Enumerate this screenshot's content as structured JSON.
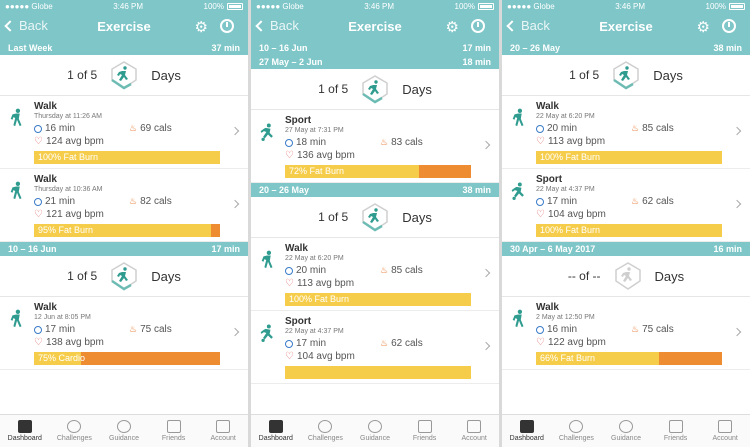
{
  "status": {
    "carrier": "Globe",
    "time": "3:46 PM",
    "battery": "100%"
  },
  "nav": {
    "back_label": "Back",
    "title": "Exercise"
  },
  "tabs": [
    "Dashboard",
    "Challenges",
    "Guidance",
    "Friends",
    "Account"
  ],
  "colors": {
    "teal": "#7fc6c8",
    "fat_burn": "#f6cd4a",
    "cardio": "#ee8c32"
  },
  "screens": [
    {
      "sections": [
        {
          "range": "Last Week",
          "total": "37 min",
          "goal_count": "1 of 5",
          "goal_unit": "Days",
          "items": [
            {
              "type": "Walk",
              "when": "Thursday at 11:26 AM",
              "duration": "16 min",
              "cals": "69 cals",
              "bpm": "124 avg bpm",
              "zone": "100% Fat Burn",
              "cardio_fraction": 0
            },
            {
              "type": "Walk",
              "when": "Thursday at 10:36 AM",
              "duration": "21 min",
              "cals": "82 cals",
              "bpm": "121 avg bpm",
              "zone": "95% Fat Burn",
              "cardio_fraction": 0.05
            }
          ]
        },
        {
          "range": "10 – 16 Jun",
          "total": "17 min",
          "goal_count": "1 of 5",
          "goal_unit": "Days",
          "items": [
            {
              "type": "Walk",
              "when": "12 Jun at 8:05 PM",
              "duration": "17 min",
              "cals": "75 cals",
              "bpm": "138 avg bpm",
              "zone": "75% Cardio",
              "cardio_fraction": 0.75
            }
          ]
        }
      ]
    },
    {
      "sections": [
        {
          "range": "10 – 16 Jun",
          "total": "17 min"
        },
        {
          "range": "27 May – 2 Jun",
          "total": "18 min",
          "goal_count": "1 of 5",
          "goal_unit": "Days",
          "items": [
            {
              "type": "Sport",
              "when": "27 May at 7:31 PM",
              "duration": "18 min",
              "cals": "83 cals",
              "bpm": "136 avg bpm",
              "zone": "72% Fat Burn",
              "cardio_fraction": 0.28
            }
          ]
        },
        {
          "range": "20 – 26 May",
          "total": "38 min",
          "goal_count": "1 of 5",
          "goal_unit": "Days",
          "items": [
            {
              "type": "Walk",
              "when": "22 May at 6:20 PM",
              "duration": "20 min",
              "cals": "85 cals",
              "bpm": "113 avg bpm",
              "zone": "100% Fat Burn",
              "cardio_fraction": 0
            },
            {
              "type": "Sport",
              "when": "22 May at 4:37 PM",
              "duration": "17 min",
              "cals": "62 cals",
              "bpm": "104 avg bpm",
              "zone": "",
              "cardio_fraction": 0
            }
          ]
        }
      ]
    },
    {
      "sections": [
        {
          "range": "20 – 26 May",
          "total": "38 min",
          "goal_count": "1 of 5",
          "goal_unit": "Days",
          "items": [
            {
              "type": "Walk",
              "when": "22 May at 6:20 PM",
              "duration": "20 min",
              "cals": "85 cals",
              "bpm": "113 avg bpm",
              "zone": "100% Fat Burn",
              "cardio_fraction": 0
            },
            {
              "type": "Sport",
              "when": "22 May at 4:37 PM",
              "duration": "17 min",
              "cals": "62 cals",
              "bpm": "104 avg bpm",
              "zone": "100% Fat Burn",
              "cardio_fraction": 0
            }
          ]
        },
        {
          "range": "30 Apr – 6 May 2017",
          "total": "16 min",
          "goal_count": "-- of --",
          "goal_unit": "Days",
          "goal_inactive": true,
          "items": [
            {
              "type": "Walk",
              "when": "2 May at 12:50 PM",
              "duration": "16 min",
              "cals": "75 cals",
              "bpm": "122 avg bpm",
              "zone": "66% Fat Burn",
              "cardio_fraction": 0.34
            }
          ]
        }
      ]
    }
  ]
}
